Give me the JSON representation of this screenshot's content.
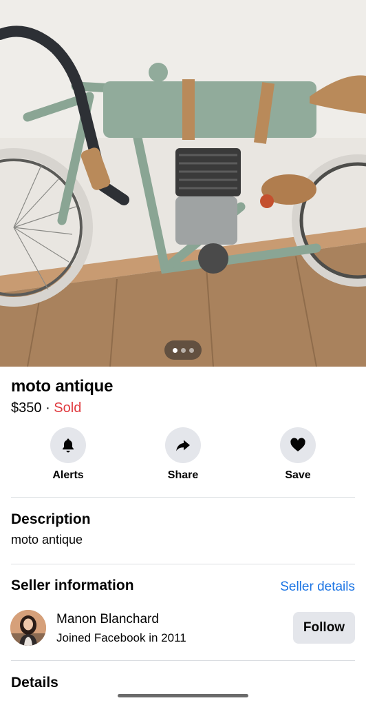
{
  "listing": {
    "title": "moto antique",
    "price": "$350",
    "separator": "·",
    "status": "Sold",
    "photo_count": 3,
    "active_photo": 1
  },
  "actions": [
    {
      "label": "Alerts",
      "icon": "bell-icon"
    },
    {
      "label": "Share",
      "icon": "share-arrow-icon"
    },
    {
      "label": "Save",
      "icon": "heart-icon"
    }
  ],
  "description": {
    "heading": "Description",
    "text": "moto antique"
  },
  "seller": {
    "heading": "Seller information",
    "details_link": "Seller details",
    "name": "Manon Blanchard",
    "joined": "Joined Facebook in 2011",
    "follow_label": "Follow"
  },
  "details": {
    "heading": "Details"
  },
  "colors": {
    "sold": "#e0393e",
    "link": "#1b74e4",
    "button_bg": "#e4e6eb"
  }
}
